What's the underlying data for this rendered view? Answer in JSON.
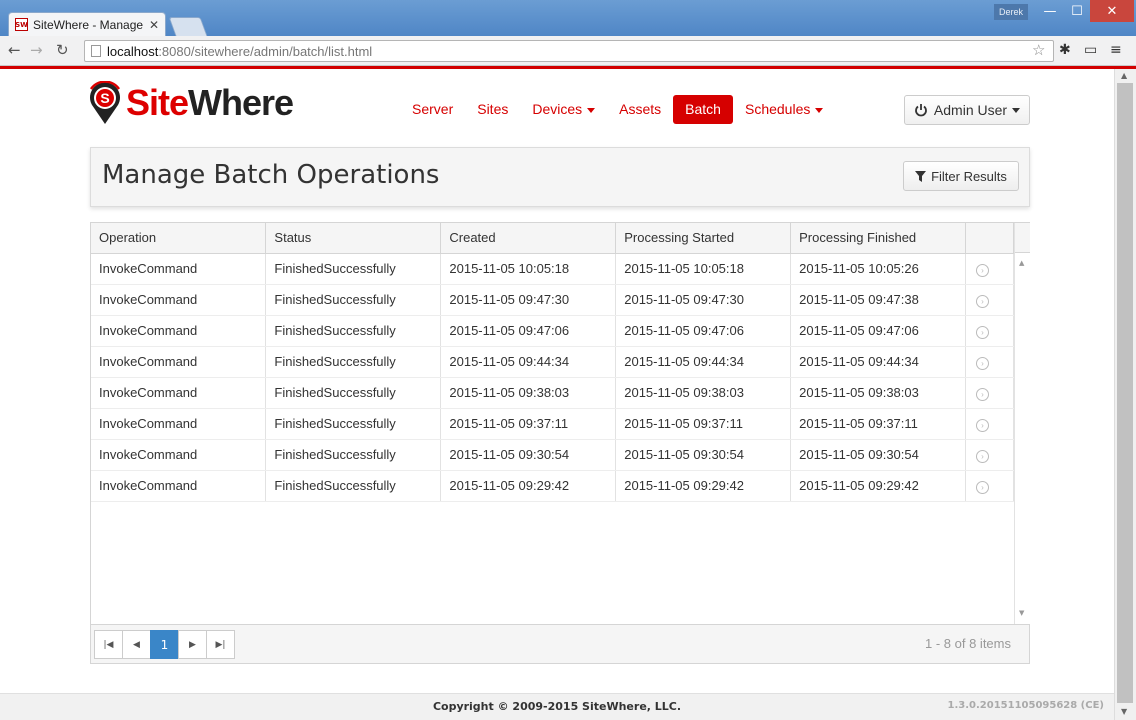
{
  "browser": {
    "tab_title": "SiteWhere - Manage",
    "favicon_text": "SW",
    "user_badge": "Derek",
    "url_host": "localhost",
    "url_rest": ":8080/sitewhere/admin/batch/list.html"
  },
  "header": {
    "logo_site": "Site",
    "logo_where": "Where",
    "nav": [
      {
        "label": "Server"
      },
      {
        "label": "Sites"
      },
      {
        "label": "Devices"
      },
      {
        "label": "Assets"
      },
      {
        "label": "Batch"
      },
      {
        "label": "Schedules"
      }
    ],
    "active_nav": "Batch",
    "user_button": "Admin User"
  },
  "title_bar": {
    "title": "Manage Batch Operations",
    "filter_label": "Filter Results"
  },
  "grid": {
    "columns": [
      "Operation",
      "Status",
      "Created",
      "Processing Started",
      "Processing Finished"
    ],
    "rows": [
      [
        "InvokeCommand",
        "FinishedSuccessfully",
        "2015-11-05 10:05:18",
        "2015-11-05 10:05:18",
        "2015-11-05 10:05:26"
      ],
      [
        "InvokeCommand",
        "FinishedSuccessfully",
        "2015-11-05 09:47:30",
        "2015-11-05 09:47:30",
        "2015-11-05 09:47:38"
      ],
      [
        "InvokeCommand",
        "FinishedSuccessfully",
        "2015-11-05 09:47:06",
        "2015-11-05 09:47:06",
        "2015-11-05 09:47:06"
      ],
      [
        "InvokeCommand",
        "FinishedSuccessfully",
        "2015-11-05 09:44:34",
        "2015-11-05 09:44:34",
        "2015-11-05 09:44:34"
      ],
      [
        "InvokeCommand",
        "FinishedSuccessfully",
        "2015-11-05 09:38:03",
        "2015-11-05 09:38:03",
        "2015-11-05 09:38:03"
      ],
      [
        "InvokeCommand",
        "FinishedSuccessfully",
        "2015-11-05 09:37:11",
        "2015-11-05 09:37:11",
        "2015-11-05 09:37:11"
      ],
      [
        "InvokeCommand",
        "FinishedSuccessfully",
        "2015-11-05 09:30:54",
        "2015-11-05 09:30:54",
        "2015-11-05 09:30:54"
      ],
      [
        "InvokeCommand",
        "FinishedSuccessfully",
        "2015-11-05 09:29:42",
        "2015-11-05 09:29:42",
        "2015-11-05 09:29:42"
      ]
    ]
  },
  "pager": {
    "current_page": "1",
    "info": "1 - 8 of 8 items"
  },
  "footer": {
    "copyright": "Copyright © 2009-2015 SiteWhere, LLC.",
    "version": "1.3.0.20151105095628 (CE)"
  },
  "colors": {
    "brand_red": "#d60000",
    "pager_active": "#3a86c8"
  }
}
